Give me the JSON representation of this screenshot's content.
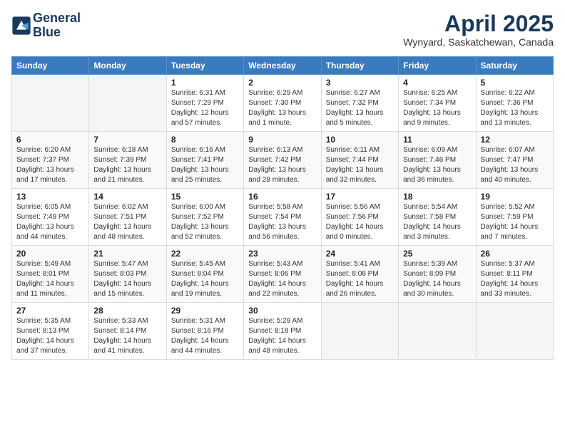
{
  "header": {
    "logo_line1": "General",
    "logo_line2": "Blue",
    "month_title": "April 2025",
    "location": "Wynyard, Saskatchewan, Canada"
  },
  "days_of_week": [
    "Sunday",
    "Monday",
    "Tuesday",
    "Wednesday",
    "Thursday",
    "Friday",
    "Saturday"
  ],
  "weeks": [
    [
      {
        "day": "",
        "info": ""
      },
      {
        "day": "",
        "info": ""
      },
      {
        "day": "1",
        "info": "Sunrise: 6:31 AM\nSunset: 7:29 PM\nDaylight: 12 hours and 57 minutes."
      },
      {
        "day": "2",
        "info": "Sunrise: 6:29 AM\nSunset: 7:30 PM\nDaylight: 13 hours and 1 minute."
      },
      {
        "day": "3",
        "info": "Sunrise: 6:27 AM\nSunset: 7:32 PM\nDaylight: 13 hours and 5 minutes."
      },
      {
        "day": "4",
        "info": "Sunrise: 6:25 AM\nSunset: 7:34 PM\nDaylight: 13 hours and 9 minutes."
      },
      {
        "day": "5",
        "info": "Sunrise: 6:22 AM\nSunset: 7:36 PM\nDaylight: 13 hours and 13 minutes."
      }
    ],
    [
      {
        "day": "6",
        "info": "Sunrise: 6:20 AM\nSunset: 7:37 PM\nDaylight: 13 hours and 17 minutes."
      },
      {
        "day": "7",
        "info": "Sunrise: 6:18 AM\nSunset: 7:39 PM\nDaylight: 13 hours and 21 minutes."
      },
      {
        "day": "8",
        "info": "Sunrise: 6:16 AM\nSunset: 7:41 PM\nDaylight: 13 hours and 25 minutes."
      },
      {
        "day": "9",
        "info": "Sunrise: 6:13 AM\nSunset: 7:42 PM\nDaylight: 13 hours and 28 minutes."
      },
      {
        "day": "10",
        "info": "Sunrise: 6:11 AM\nSunset: 7:44 PM\nDaylight: 13 hours and 32 minutes."
      },
      {
        "day": "11",
        "info": "Sunrise: 6:09 AM\nSunset: 7:46 PM\nDaylight: 13 hours and 36 minutes."
      },
      {
        "day": "12",
        "info": "Sunrise: 6:07 AM\nSunset: 7:47 PM\nDaylight: 13 hours and 40 minutes."
      }
    ],
    [
      {
        "day": "13",
        "info": "Sunrise: 6:05 AM\nSunset: 7:49 PM\nDaylight: 13 hours and 44 minutes."
      },
      {
        "day": "14",
        "info": "Sunrise: 6:02 AM\nSunset: 7:51 PM\nDaylight: 13 hours and 48 minutes."
      },
      {
        "day": "15",
        "info": "Sunrise: 6:00 AM\nSunset: 7:52 PM\nDaylight: 13 hours and 52 minutes."
      },
      {
        "day": "16",
        "info": "Sunrise: 5:58 AM\nSunset: 7:54 PM\nDaylight: 13 hours and 56 minutes."
      },
      {
        "day": "17",
        "info": "Sunrise: 5:56 AM\nSunset: 7:56 PM\nDaylight: 14 hours and 0 minutes."
      },
      {
        "day": "18",
        "info": "Sunrise: 5:54 AM\nSunset: 7:58 PM\nDaylight: 14 hours and 3 minutes."
      },
      {
        "day": "19",
        "info": "Sunrise: 5:52 AM\nSunset: 7:59 PM\nDaylight: 14 hours and 7 minutes."
      }
    ],
    [
      {
        "day": "20",
        "info": "Sunrise: 5:49 AM\nSunset: 8:01 PM\nDaylight: 14 hours and 11 minutes."
      },
      {
        "day": "21",
        "info": "Sunrise: 5:47 AM\nSunset: 8:03 PM\nDaylight: 14 hours and 15 minutes."
      },
      {
        "day": "22",
        "info": "Sunrise: 5:45 AM\nSunset: 8:04 PM\nDaylight: 14 hours and 19 minutes."
      },
      {
        "day": "23",
        "info": "Sunrise: 5:43 AM\nSunset: 8:06 PM\nDaylight: 14 hours and 22 minutes."
      },
      {
        "day": "24",
        "info": "Sunrise: 5:41 AM\nSunset: 8:08 PM\nDaylight: 14 hours and 26 minutes."
      },
      {
        "day": "25",
        "info": "Sunrise: 5:39 AM\nSunset: 8:09 PM\nDaylight: 14 hours and 30 minutes."
      },
      {
        "day": "26",
        "info": "Sunrise: 5:37 AM\nSunset: 8:11 PM\nDaylight: 14 hours and 33 minutes."
      }
    ],
    [
      {
        "day": "27",
        "info": "Sunrise: 5:35 AM\nSunset: 8:13 PM\nDaylight: 14 hours and 37 minutes."
      },
      {
        "day": "28",
        "info": "Sunrise: 5:33 AM\nSunset: 8:14 PM\nDaylight: 14 hours and 41 minutes."
      },
      {
        "day": "29",
        "info": "Sunrise: 5:31 AM\nSunset: 8:16 PM\nDaylight: 14 hours and 44 minutes."
      },
      {
        "day": "30",
        "info": "Sunrise: 5:29 AM\nSunset: 8:18 PM\nDaylight: 14 hours and 48 minutes."
      },
      {
        "day": "",
        "info": ""
      },
      {
        "day": "",
        "info": ""
      },
      {
        "day": "",
        "info": ""
      }
    ]
  ]
}
